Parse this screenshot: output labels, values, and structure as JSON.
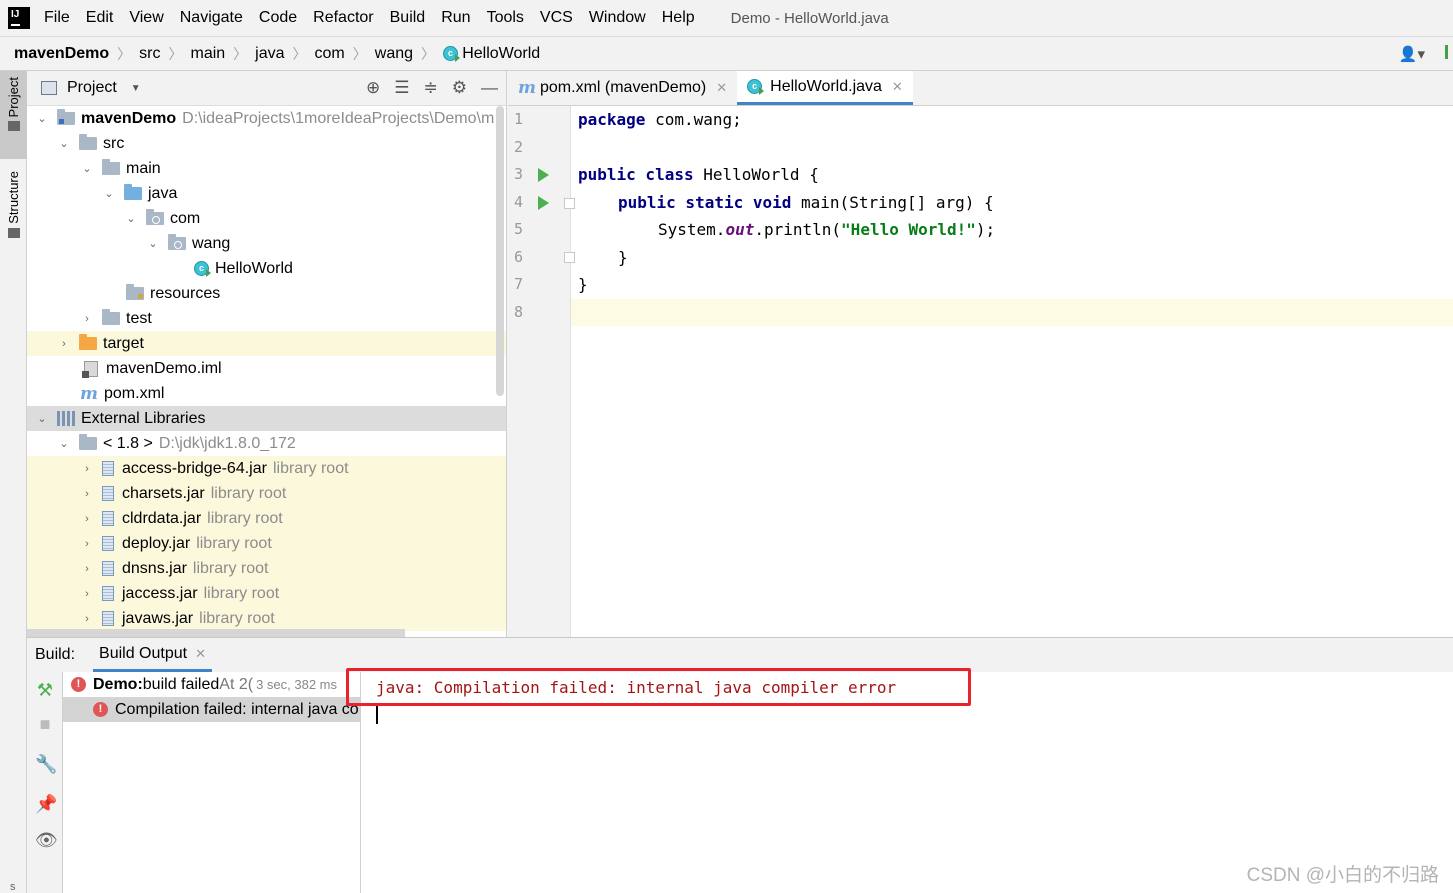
{
  "menubar": {
    "items": [
      "File",
      "Edit",
      "View",
      "Navigate",
      "Code",
      "Refactor",
      "Build",
      "Run",
      "Tools",
      "VCS",
      "Window",
      "Help"
    ],
    "window_title": "Demo - HelloWorld.java"
  },
  "breadcrumb": [
    "mavenDemo",
    "src",
    "main",
    "java",
    "com",
    "wang",
    "HelloWorld"
  ],
  "user_menu": "👤▾",
  "left_strip": {
    "project": "Project",
    "structure": "Structure"
  },
  "project_panel": {
    "title": "Project",
    "tree": [
      {
        "label": "mavenDemo",
        "extra": "D:\\ideaProjects\\1moreIdeaProjects\\Demo\\m"
      },
      {
        "label": "src"
      },
      {
        "label": "main"
      },
      {
        "label": "java"
      },
      {
        "label": "com"
      },
      {
        "label": "wang"
      },
      {
        "label": "HelloWorld"
      },
      {
        "label": "resources"
      },
      {
        "label": "test"
      },
      {
        "label": "target"
      },
      {
        "label": "mavenDemo.iml"
      },
      {
        "label": "pom.xml"
      },
      {
        "label": "External Libraries"
      },
      {
        "label": "< 1.8 >",
        "extra": "D:\\jdk\\jdk1.8.0_172"
      },
      {
        "label": "access-bridge-64.jar",
        "extra": "library root"
      },
      {
        "label": "charsets.jar",
        "extra": "library root"
      },
      {
        "label": "cldrdata.jar",
        "extra": "library root"
      },
      {
        "label": "deploy.jar",
        "extra": "library root"
      },
      {
        "label": "dnsns.jar",
        "extra": "library root"
      },
      {
        "label": "jaccess.jar",
        "extra": "library root"
      },
      {
        "label": "javaws.jar",
        "extra": "library root"
      }
    ]
  },
  "editor": {
    "tabs": [
      "pom.xml (mavenDemo)",
      "HelloWorld.java"
    ],
    "line_numbers": [
      "1",
      "2",
      "3",
      "4",
      "5",
      "6",
      "7",
      "8"
    ],
    "code": {
      "l1_kw": "package",
      "l1_rest": " com.wang;",
      "l3_kw": "public class",
      "l3_rest": " HelloWorld {",
      "l4_kw": "public static void",
      "l4_rest": " main(String[] arg) {",
      "l5_a": "System.",
      "l5_field": "out",
      "l5_b": ".println(",
      "l5_str": "\"Hello World!\"",
      "l5_c": ");",
      "l6": "}",
      "l7": "}"
    }
  },
  "build": {
    "label": "Build:",
    "tab": "Build Output",
    "rows": {
      "r1_bold": "Demo:",
      "r1_text": " build failed",
      "r1_at": " At 2(",
      "r1_time": "3 sec, 382 ms",
      "r2_text": "Compilation failed: internal java co"
    },
    "console_error": "java: Compilation failed: internal java compiler error"
  },
  "watermark": "CSDN @小白的不归路",
  "bottom_letter": "s",
  "colors": {
    "accent": "#4083c9",
    "error": "#e8232c",
    "keyword": "#000080",
    "string": "#067d17"
  }
}
